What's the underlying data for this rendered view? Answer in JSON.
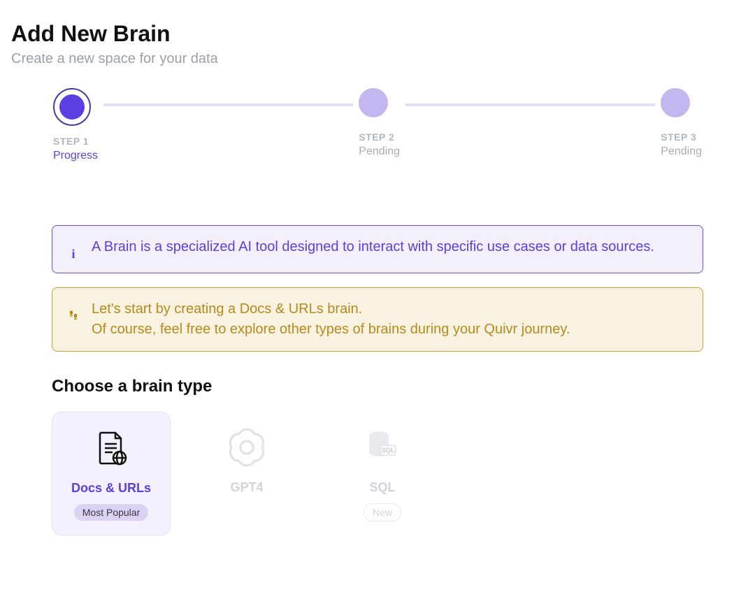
{
  "header": {
    "title": "Add New Brain",
    "subtitle": "Create a new space for your data"
  },
  "stepper": {
    "steps": [
      {
        "label": "STEP 1",
        "status": "Progress"
      },
      {
        "label": "STEP 2",
        "status": "Pending"
      },
      {
        "label": "STEP 3",
        "status": "Pending"
      }
    ]
  },
  "callouts": {
    "info": "A Brain is a specialized AI tool designed to interact with specific use cases or data sources.",
    "tip_line1": "Let's start by creating a Docs & URLs brain.",
    "tip_line2": "Of course, feel free to explore other types of brains during your Quivr journey."
  },
  "section": {
    "choose_title": "Choose a brain type"
  },
  "cards": [
    {
      "label": "Docs & URLs",
      "badge": "Most Popular",
      "selected": true,
      "icon": "document-globe-icon"
    },
    {
      "label": "GPT4",
      "badge": "",
      "selected": false,
      "icon": "openai-icon"
    },
    {
      "label": "SQL",
      "badge": "New",
      "selected": false,
      "icon": "database-sql-icon"
    }
  ]
}
